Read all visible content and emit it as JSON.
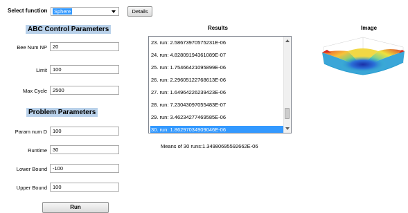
{
  "header": {
    "select_label": "Select function",
    "function_value": "Sphere",
    "details_label": "Details"
  },
  "abc": {
    "title": "ABC Control Parameters",
    "bee_num_label": "Bee Num NP",
    "bee_num_value": "20",
    "limit_label": "Limit",
    "limit_value": "100",
    "max_cycle_label": "Max Cycle",
    "max_cycle_value": "2500"
  },
  "problem": {
    "title": "Problem Parameters",
    "param_num_label": "Param num D",
    "param_num_value": "100",
    "runtime_label": "Runtime",
    "runtime_value": "30",
    "lower_bound_label": "Lower Bound",
    "lower_bound_value": "-100",
    "upper_bound_label": "Upper Bound",
    "upper_bound_value": "100"
  },
  "run_label": "Run",
  "results": {
    "title": "Results",
    "items": [
      "23. run: 2.58673970575231E-06",
      "24. run: 4.82809194361089E-07",
      "25. run: 1.75466421095899E-06",
      "26. run: 2.29605122768613E-06",
      "27. run: 1.64964226239423E-06",
      "28. run: 7.23043097055483E-07",
      "29. run: 3.46234277469585E-06",
      "30. run: 1.86297034909046E-06"
    ],
    "selected_index": 7,
    "mean_text": "Means of 30 runs:1.34980695592662E-06"
  },
  "image": {
    "title": "Image"
  },
  "colors": {
    "section_header_bg": "#b9d1ea",
    "selection": "#3399ff"
  }
}
